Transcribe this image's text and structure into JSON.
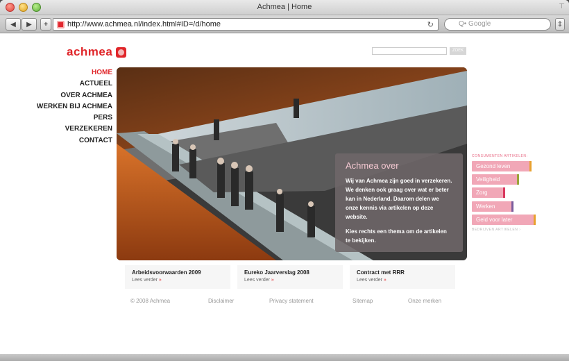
{
  "window": {
    "title": "Achmea | Home"
  },
  "browser": {
    "url": "http://www.achmea.nl/index.html#ID=/d/home",
    "search_placeholder": "Q• Google",
    "back_label": "◀",
    "forward_label": "▶",
    "add_label": "+",
    "reload_label": "↻"
  },
  "site": {
    "logo_text": "achmea",
    "search_button": "ZOEK"
  },
  "nav": [
    "HOME",
    "ACTUEEL",
    "OVER ACHMEA",
    "WERKEN BIJ ACHMEA",
    "PERS",
    "VERZEKEREN",
    "CONTACT"
  ],
  "about": {
    "title": "Achmea over",
    "text1": "Wij van Achmea zijn goed in verzekeren. We denken ook graag over wat er beter kan in Nederland. Daarom delen we onze kennis via artikelen op deze website.",
    "text2": "Kies rechts een thema om de artikelen te bekijken."
  },
  "categories": {
    "header": "CONSUMENTEN ARTIKELEN:",
    "items": [
      {
        "label": "Gezond leven",
        "accent": "#e8a12e"
      },
      {
        "label": "Veiligheid",
        "accent": "#9aa33a"
      },
      {
        "label": "Zorg",
        "accent": "#d9375d"
      },
      {
        "label": "Werken",
        "accent": "#7a5b9c"
      },
      {
        "label": "Geld voor later",
        "accent": "#e8a12e"
      }
    ],
    "business_link": "BEDRIJVEN ARTIKELEN ›"
  },
  "news": [
    {
      "title": "Arbeidsvoorwaarden 2009",
      "link": "Lees verder",
      "arrow": "»"
    },
    {
      "title": "Eureko Jaarverslag 2008",
      "link": "Lees verder",
      "arrow": "»"
    },
    {
      "title": "Contract met RRR",
      "link": "Lees verder",
      "arrow": "»"
    }
  ],
  "footer": [
    "© 2008 Achmea",
    "Disclaimer",
    "Privacy statement",
    "Sitemap",
    "Onze merken"
  ],
  "colors": {
    "brand": "#e0262a",
    "category_pink": "#f1a7b7",
    "about_bg": "#6e6769"
  }
}
